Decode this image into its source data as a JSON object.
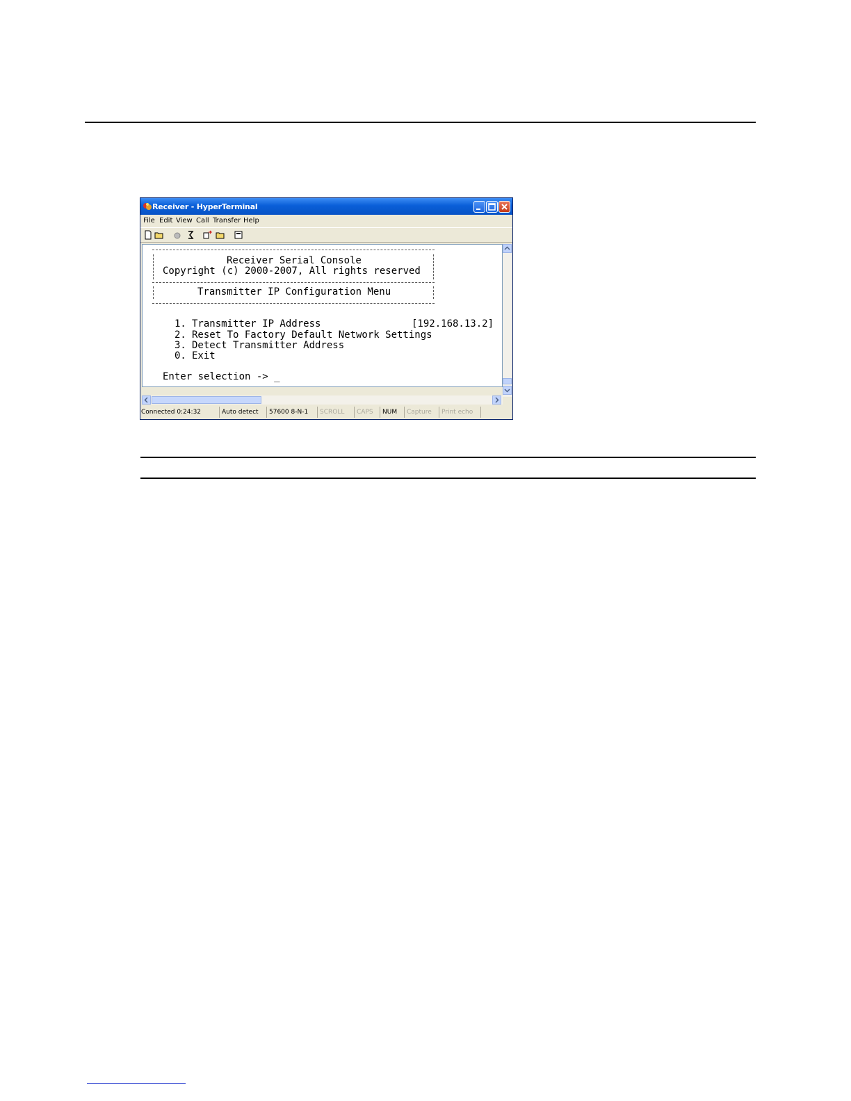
{
  "window": {
    "title": "Receiver - HyperTerminal",
    "menu": [
      "File",
      "Edit",
      "View",
      "Call",
      "Transfer",
      "Help"
    ],
    "toolbar_icons": [
      "new-file-icon",
      "open-folder-icon",
      "connect-icon",
      "disconnect-icon",
      "send-icon",
      "receive-icon",
      "properties-icon"
    ]
  },
  "terminal": {
    "header_title": "Receiver Serial Console",
    "header_copyright": "Copyright (c) 2000-2007, All rights reserved",
    "menu_title": "Transmitter IP Configuration Menu",
    "options": [
      {
        "number": "1.",
        "label": "Transmitter IP Address",
        "value": "[192.168.13.2]"
      },
      {
        "number": "2.",
        "label": "Reset To Factory Default Network Settings"
      },
      {
        "number": "3.",
        "label": "Detect Transmitter Address"
      },
      {
        "number": "0.",
        "label": "Exit"
      }
    ],
    "prompt": "Enter selection -> _"
  },
  "status": {
    "connected": "Connected 0:24:32",
    "detect": "Auto detect",
    "port": "57600 8-N-1",
    "scroll": "SCROLL",
    "caps": "CAPS",
    "num": "NUM",
    "capture": "Capture",
    "print_echo": "Print echo"
  }
}
